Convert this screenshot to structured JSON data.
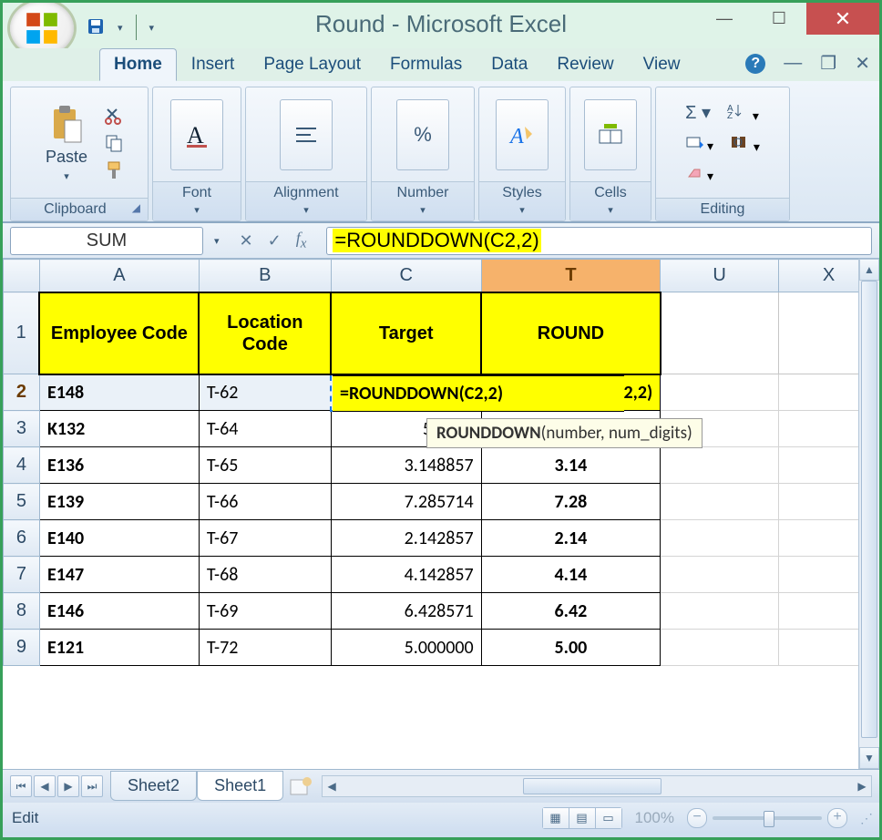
{
  "window": {
    "title": "Round - Microsoft Excel"
  },
  "tabs": [
    "Home",
    "Insert",
    "Page Layout",
    "Formulas",
    "Data",
    "Review",
    "View"
  ],
  "active_tab": "Home",
  "ribbon": {
    "clipboard": {
      "title": "Clipboard",
      "paste": "Paste"
    },
    "font": {
      "title": "Font"
    },
    "alignment": {
      "title": "Alignment"
    },
    "number": {
      "title": "Number"
    },
    "styles": {
      "title": "Styles"
    },
    "cells": {
      "title": "Cells"
    },
    "editing": {
      "title": "Editing"
    }
  },
  "formula_bar": {
    "name_box": "SUM",
    "formula": "=ROUNDDOWN(C2,2)"
  },
  "columns": [
    "A",
    "B",
    "C",
    "T",
    "U",
    "X"
  ],
  "active_column": "T",
  "active_row": 2,
  "headers": [
    "Employee Code",
    "Location Code",
    "Target",
    "ROUND"
  ],
  "editing_cell_text": "=ROUNDDOWN(C2,2)",
  "tooltip": {
    "fn": "ROUNDDOWN",
    "args": "(number, num_digits)"
  },
  "rows": [
    {
      "r": 2,
      "emp": "E148",
      "loc": "T-62",
      "target": "",
      "round": ""
    },
    {
      "r": 3,
      "emp": "K132",
      "loc": "T-64",
      "target": "5.2857",
      "round": ""
    },
    {
      "r": 4,
      "emp": "E136",
      "loc": "T-65",
      "target": "3.148857",
      "round": "3.14"
    },
    {
      "r": 5,
      "emp": "E139",
      "loc": "T-66",
      "target": "7.285714",
      "round": "7.28"
    },
    {
      "r": 6,
      "emp": "E140",
      "loc": "T-67",
      "target": "2.142857",
      "round": "2.14"
    },
    {
      "r": 7,
      "emp": "E147",
      "loc": "T-68",
      "target": "4.142857",
      "round": "4.14"
    },
    {
      "r": 8,
      "emp": "E146",
      "loc": "T-69",
      "target": "6.428571",
      "round": "6.42"
    },
    {
      "r": 9,
      "emp": "E121",
      "loc": "T-72",
      "target": "5.000000",
      "round": "5.00"
    }
  ],
  "sheets": [
    "Sheet2",
    "Sheet1"
  ],
  "active_sheet": "Sheet1",
  "statusbar": {
    "mode": "Edit",
    "zoom": "100%"
  }
}
